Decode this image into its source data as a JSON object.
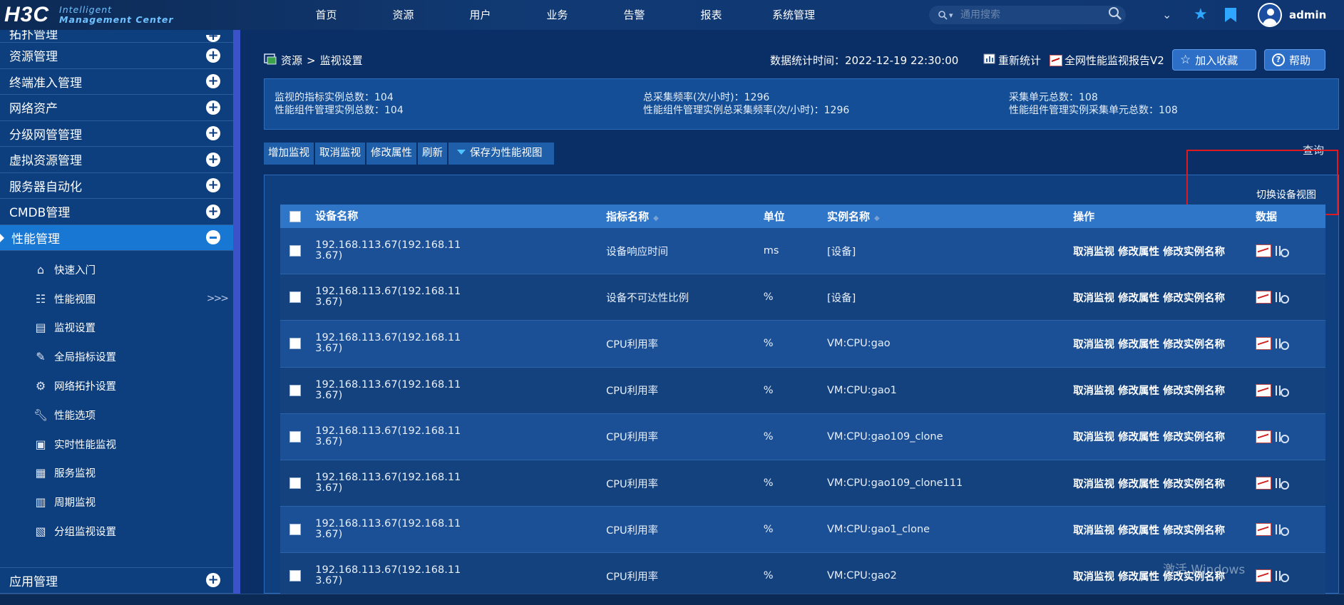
{
  "header": {
    "logo": "H3C",
    "logo_sub_1": "Intelligent",
    "logo_sub_2": "Management Center",
    "nav": [
      "首页",
      "资源",
      "用户",
      "业务",
      "告警",
      "报表",
      "系统管理"
    ],
    "search_placeholder": "通用搜索",
    "username": "admin"
  },
  "sidebar": {
    "items_top": [
      {
        "label": "拓扑管理",
        "partial": true
      },
      {
        "label": "资源管理"
      },
      {
        "label": "终端准入管理"
      },
      {
        "label": "网络资产"
      },
      {
        "label": "分级网管管理"
      },
      {
        "label": "虚拟资源管理"
      },
      {
        "label": "服务器自动化"
      },
      {
        "label": "CMDB管理"
      }
    ],
    "active": "性能管理",
    "submenu": [
      {
        "label": "快速入门",
        "icon": "home-icon"
      },
      {
        "label": "性能视图",
        "icon": "table-icon"
      },
      {
        "label": "监视设置",
        "icon": "monitor-settings-icon"
      },
      {
        "label": "全局指标设置",
        "icon": "global-metric-icon"
      },
      {
        "label": "网络拓扑设置",
        "icon": "topology-icon"
      },
      {
        "label": "性能选项",
        "icon": "wrench-icon"
      },
      {
        "label": "实时性能监视",
        "icon": "realtime-icon"
      },
      {
        "label": "服务监视",
        "icon": "service-icon"
      },
      {
        "label": "周期监视",
        "icon": "calendar-icon"
      },
      {
        "label": "分组监视设置",
        "icon": "group-icon"
      }
    ],
    "submenu_arrow": ">>>",
    "bottom": "应用管理"
  },
  "main": {
    "breadcrumb_root": "资源",
    "breadcrumb_sep": ">",
    "breadcrumb_current": "监视设置",
    "stat_time": "数据统计时间：2022-12-19 22:30:00",
    "recount": "重新统计",
    "report": "全网性能监视报告V2",
    "add_favorite": "加入收藏",
    "help": "帮助",
    "summary": {
      "a1": "监视的指标实例总数：104",
      "a2": "性能组件管理实例总数：104",
      "b1": "总采集频率(次/小时)：1296",
      "b2": "性能组件管理实例总采集频率(次/小时)：1296",
      "c1": "采集单元总数：108",
      "c2": "性能组件管理实例采集单元总数：108"
    },
    "toolbar": [
      "增加监视",
      "取消监视",
      "修改属性",
      "刷新"
    ],
    "save_view": "保存为性能视图",
    "query": "查询",
    "switch_view": "切换设备视图",
    "table": {
      "headers": {
        "device": "设备名称",
        "metric": "指标名称",
        "unit": "单位",
        "instance": "实例名称",
        "ops": "操作",
        "data": "数据"
      },
      "ops": [
        "取消监视",
        "修改属性",
        "修改实例名称"
      ],
      "rows": [
        {
          "device": "192.168.113.67(192.168.11",
          "device2": "3.67)",
          "metric": "设备响应时间",
          "unit": "ms",
          "instance": "[设备]"
        },
        {
          "device": "192.168.113.67(192.168.11",
          "device2": "3.67)",
          "metric": "设备不可达性比例",
          "unit": "%",
          "instance": "[设备]"
        },
        {
          "device": "192.168.113.67(192.168.11",
          "device2": "3.67)",
          "metric": "CPU利用率",
          "unit": "%",
          "instance": "VM:CPU:gao"
        },
        {
          "device": "192.168.113.67(192.168.11",
          "device2": "3.67)",
          "metric": "CPU利用率",
          "unit": "%",
          "instance": "VM:CPU:gao1"
        },
        {
          "device": "192.168.113.67(192.168.11",
          "device2": "3.67)",
          "metric": "CPU利用率",
          "unit": "%",
          "instance": "VM:CPU:gao109_clone"
        },
        {
          "device": "192.168.113.67(192.168.11",
          "device2": "3.67)",
          "metric": "CPU利用率",
          "unit": "%",
          "instance": "VM:CPU:gao109_clone111"
        },
        {
          "device": "192.168.113.67(192.168.11",
          "device2": "3.67)",
          "metric": "CPU利用率",
          "unit": "%",
          "instance": "VM:CPU:gao1_clone"
        },
        {
          "device": "192.168.113.67(192.168.11",
          "device2": "3.67)",
          "metric": "CPU利用率",
          "unit": "%",
          "instance": "VM:CPU:gao2"
        }
      ]
    },
    "watermark": "激活 Windows"
  }
}
